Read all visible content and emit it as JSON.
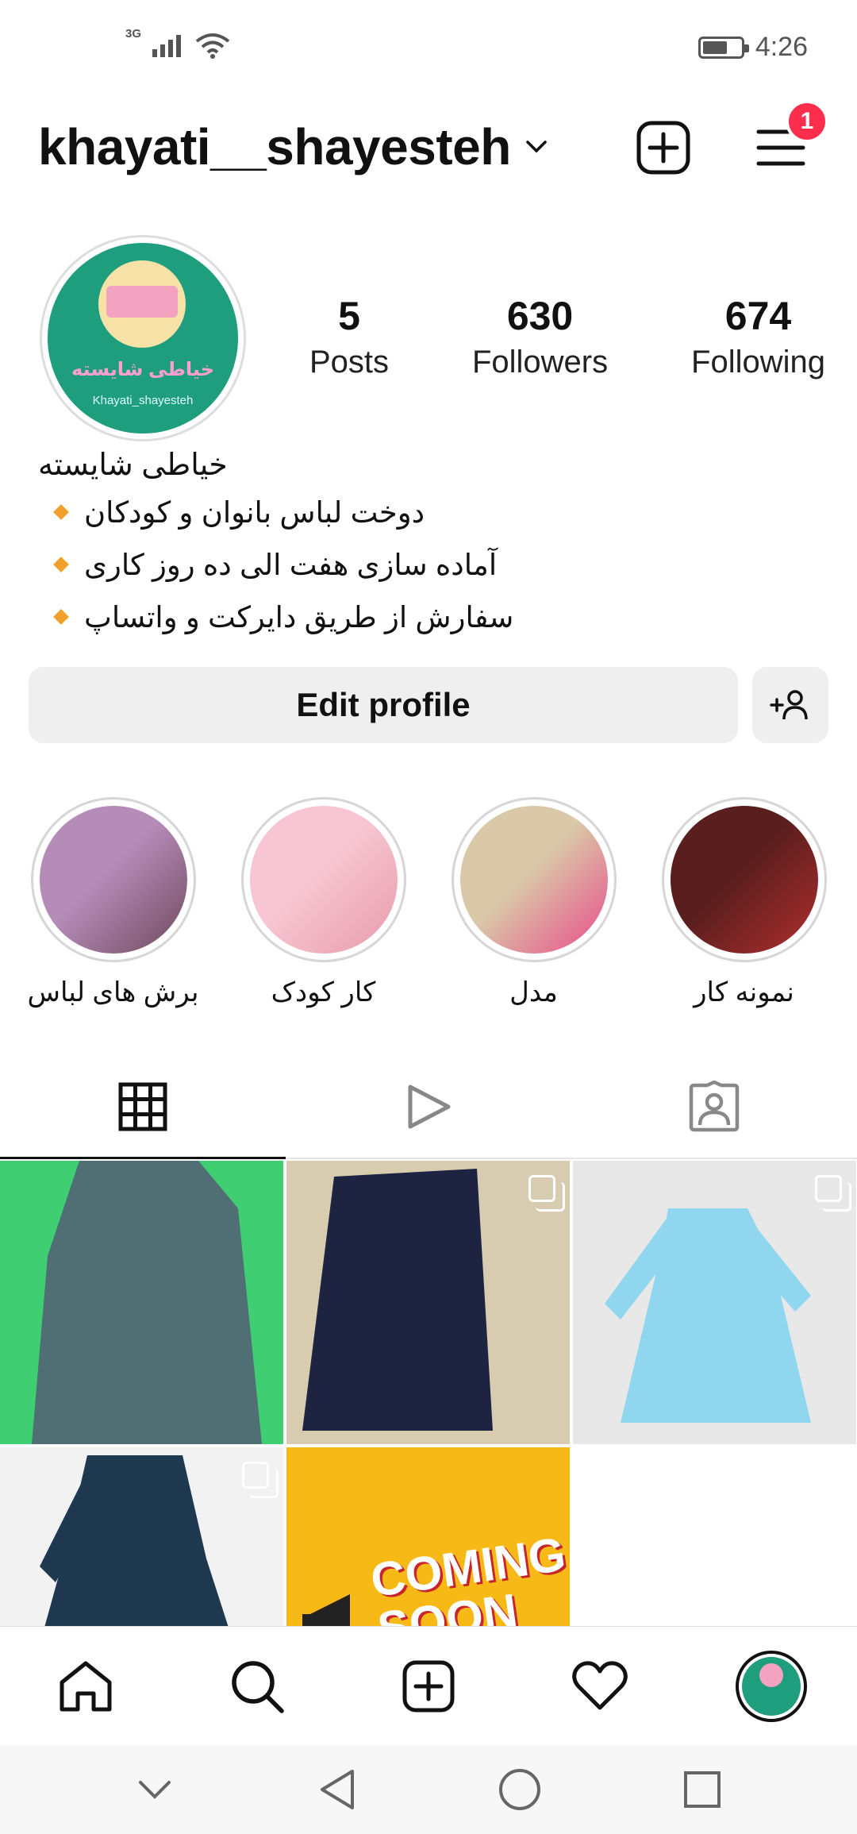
{
  "status_bar": {
    "network_label": "3G",
    "time": "4:26",
    "battery_level": 0.65
  },
  "header": {
    "username": "khayati__shayesteh",
    "notification_count": "1"
  },
  "profile": {
    "avatar_text_fa": "خیاطی شایسته",
    "avatar_text_en": "Khayati_shayesteh",
    "stats": [
      {
        "value": "5",
        "label": "Posts"
      },
      {
        "value": "630",
        "label": "Followers"
      },
      {
        "value": "674",
        "label": "Following"
      }
    ],
    "bio_name": "خیاطی شایسته",
    "bio_lines": [
      "دوخت لباس بانوان و کودکان",
      "آماده سازی  هفت الی ده روز کاری",
      "سفارش از طریق دایرکت و واتساپ"
    ]
  },
  "actions": {
    "edit_profile": "Edit profile"
  },
  "highlights": [
    {
      "label": "برش های لباس",
      "color_a": "#b58bb8",
      "color_b": "#6e4a5c"
    },
    {
      "label": "کار کودک",
      "color_a": "#f7c6d2",
      "color_b": "#e89aa9"
    },
    {
      "label": "مدل",
      "color_a": "#d9c9a8",
      "color_b": "#e94b8a"
    },
    {
      "label": "نمونه کار",
      "color_a": "#5a1e1e",
      "color_b": "#b12e2e"
    }
  ],
  "posts": [
    {
      "type": "image",
      "bg": "#3fce72",
      "fg": "#4f6f74",
      "multi": false
    },
    {
      "type": "image",
      "bg": "#d8ccb0",
      "fg": "#1d2340",
      "multi": true
    },
    {
      "type": "image",
      "bg": "#e8e8e8",
      "fg": "#8fd6ee",
      "multi": true
    },
    {
      "type": "image",
      "bg": "#f2f2f2",
      "fg": "#1e3850",
      "multi": true
    },
    {
      "type": "coming",
      "bg": "#f7b915",
      "text": "COMING\nSOON",
      "multi": false
    }
  ]
}
